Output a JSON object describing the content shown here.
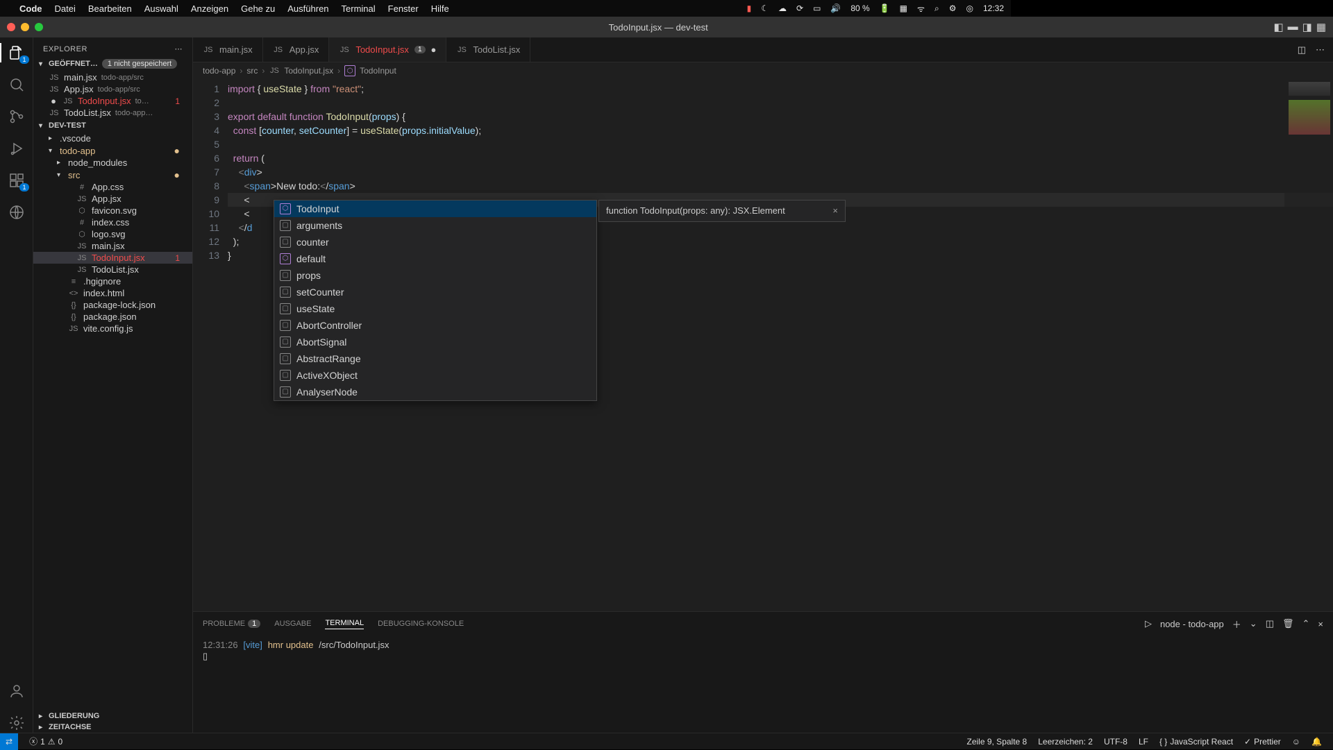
{
  "mac_menu": {
    "app": "Code",
    "items": [
      "Datei",
      "Bearbeiten",
      "Auswahl",
      "Anzeigen",
      "Gehe zu",
      "Ausführen",
      "Terminal",
      "Fenster",
      "Hilfe"
    ],
    "right": {
      "battery": "80 %",
      "time": "12:32"
    }
  },
  "window_title": "TodoInput.jsx — dev-test",
  "activity": {
    "explorer_badge": "1",
    "scm_badge": "1"
  },
  "explorer": {
    "title": "EXPLORER",
    "open_editors_label": "GEÖFFNET…",
    "unsaved_pill": "1 nicht gespeichert",
    "open_editors": [
      {
        "name": "main.jsx",
        "hint": "todo-app/src"
      },
      {
        "name": "App.jsx",
        "hint": "todo-app/src"
      },
      {
        "name": "TodoInput.jsx",
        "hint": "to…",
        "error": true,
        "count": "1",
        "modified_dot": true
      },
      {
        "name": "TodoList.jsx",
        "hint": "todo-app…"
      }
    ],
    "workspace": "DEV-TEST",
    "tree": [
      {
        "depth": 1,
        "chev": "▸",
        "name": ".vscode"
      },
      {
        "depth": 1,
        "chev": "▾",
        "name": "todo-app",
        "cls": "modified",
        "dot": "●"
      },
      {
        "depth": 2,
        "chev": "▸",
        "name": "node_modules"
      },
      {
        "depth": 2,
        "chev": "▾",
        "name": "src",
        "cls": "modified",
        "dot": "●"
      },
      {
        "depth": 3,
        "icon": "#",
        "name": "App.css"
      },
      {
        "depth": 3,
        "icon": "JS",
        "name": "App.jsx"
      },
      {
        "depth": 3,
        "icon": "⬡",
        "name": "favicon.svg"
      },
      {
        "depth": 3,
        "icon": "#",
        "name": "index.css"
      },
      {
        "depth": 3,
        "icon": "⬡",
        "name": "logo.svg"
      },
      {
        "depth": 3,
        "icon": "JS",
        "name": "main.jsx"
      },
      {
        "depth": 3,
        "icon": "JS",
        "name": "TodoInput.jsx",
        "cls": "error",
        "count": "1",
        "selected": true
      },
      {
        "depth": 3,
        "icon": "JS",
        "name": "TodoList.jsx"
      },
      {
        "depth": 2,
        "icon": "≡",
        "name": ".hgignore"
      },
      {
        "depth": 2,
        "icon": "<>",
        "name": "index.html"
      },
      {
        "depth": 2,
        "icon": "{}",
        "name": "package-lock.json"
      },
      {
        "depth": 2,
        "icon": "{}",
        "name": "package.json"
      },
      {
        "depth": 2,
        "icon": "JS",
        "name": "vite.config.js"
      }
    ],
    "outline": "GLIEDERUNG",
    "timeline": "ZEITACHSE"
  },
  "tabs": [
    {
      "label": "main.jsx"
    },
    {
      "label": "App.jsx"
    },
    {
      "label": "TodoInput.jsx",
      "active": true,
      "error": true,
      "badge": "1",
      "modified": true
    },
    {
      "label": "TodoList.jsx"
    }
  ],
  "breadcrumbs": [
    "todo-app",
    "src",
    "TodoInput.jsx",
    "TodoInput"
  ],
  "code": {
    "lines": [
      "import { useState } from \"react\";",
      "",
      "export default function TodoInput(props) {",
      "  const [counter, setCounter] = useState(props.initialValue);",
      "",
      "  return (",
      "    <div>",
      "      <span>New todo:</span>",
      "      <",
      "      <",
      "    </d",
      "  );",
      "}"
    ],
    "current_line_index": 8
  },
  "suggest": {
    "items": [
      {
        "label": "TodoInput",
        "kind": "cube",
        "selected": true
      },
      {
        "label": "arguments",
        "kind": "var"
      },
      {
        "label": "counter",
        "kind": "var"
      },
      {
        "label": "default",
        "kind": "cube"
      },
      {
        "label": "props",
        "kind": "var"
      },
      {
        "label": "setCounter",
        "kind": "var"
      },
      {
        "label": "useState",
        "kind": "var"
      },
      {
        "label": "AbortController",
        "kind": "var"
      },
      {
        "label": "AbortSignal",
        "kind": "var"
      },
      {
        "label": "AbstractRange",
        "kind": "var"
      },
      {
        "label": "ActiveXObject",
        "kind": "var"
      },
      {
        "label": "AnalyserNode",
        "kind": "var"
      }
    ],
    "doc": "function TodoInput(props: any): JSX.Element"
  },
  "panel": {
    "tabs": {
      "problems": "PROBLEME",
      "problems_count": "1",
      "output": "AUSGABE",
      "terminal": "TERMINAL",
      "debug": "DEBUGGING-KONSOLE"
    },
    "term_label": "node - todo-app",
    "line": {
      "time": "12:31:26",
      "tag": "[vite]",
      "msg": "hmr update",
      "path": "/src/TodoInput.jsx"
    },
    "cursor": "▯"
  },
  "status": {
    "errors": "1",
    "warnings": "0",
    "cursor": "Zeile 9, Spalte 8",
    "indent": "Leerzeichen: 2",
    "encoding": "UTF-8",
    "eol": "LF",
    "lang": "JavaScript React",
    "prettier": "Prettier"
  }
}
